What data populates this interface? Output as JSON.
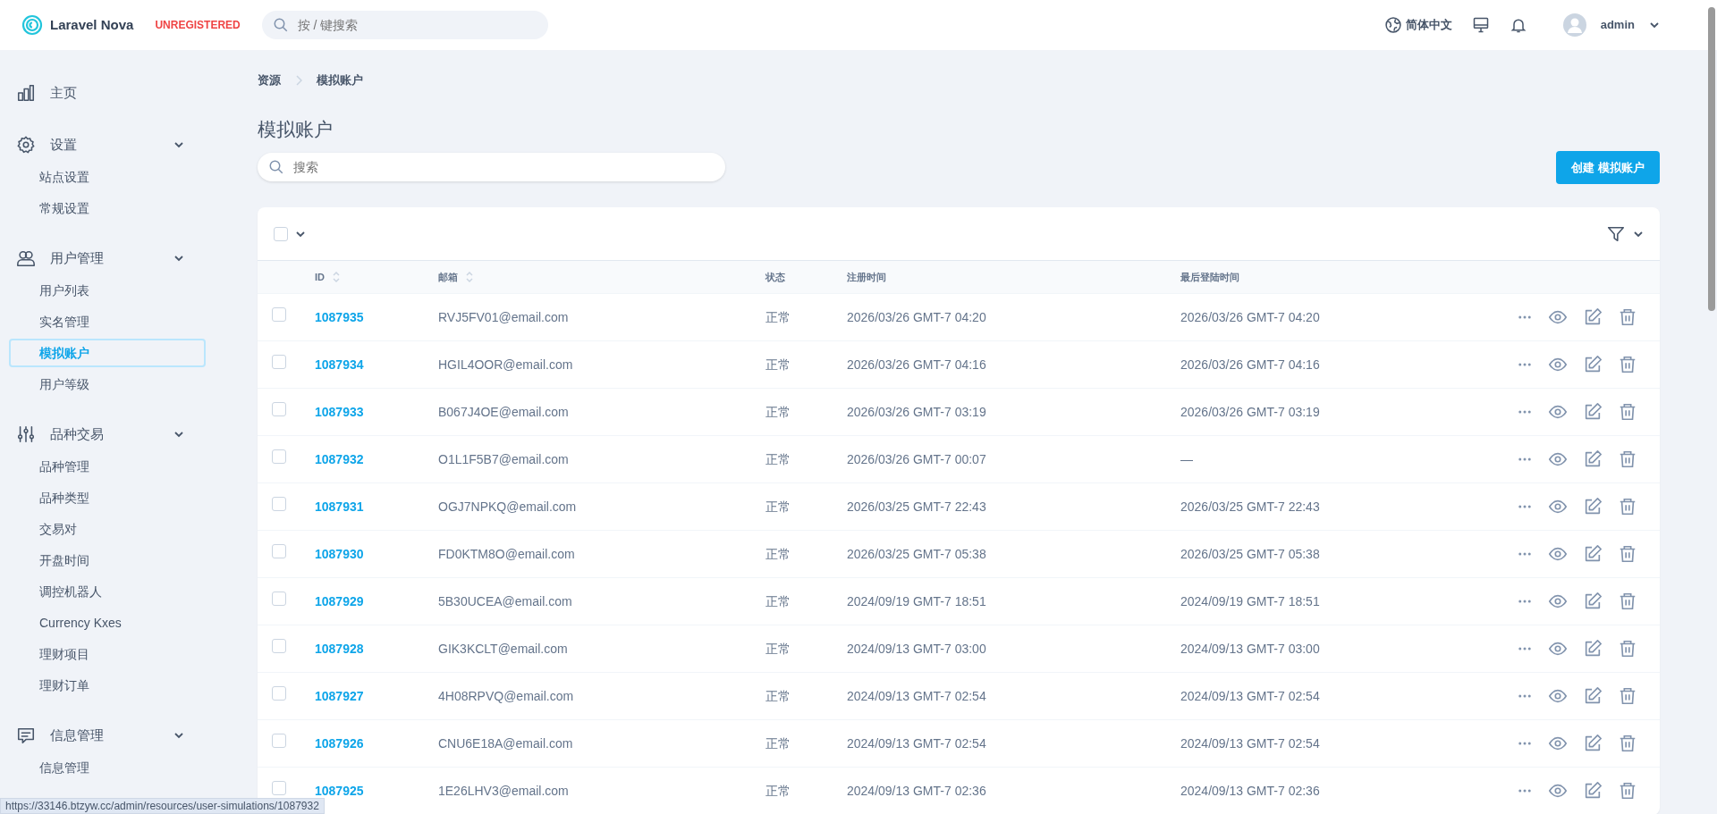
{
  "header": {
    "brand": "Laravel Nova",
    "license": "UNREGISTERED",
    "search": {
      "placeholder": "按 / 键搜索"
    },
    "language": "简体中文",
    "user": "admin"
  },
  "sidebar": {
    "groups": [
      {
        "label": "主页"
      },
      {
        "label": "设置",
        "expanded": true,
        "children": [
          {
            "label": "站点设置",
            "selected": false
          },
          {
            "label": "常规设置",
            "selected": false
          }
        ]
      },
      {
        "label": "用户管理",
        "expanded": true,
        "children": [
          {
            "label": "用户列表",
            "selected": false
          },
          {
            "label": "实名管理",
            "selected": false
          },
          {
            "label": "模拟账户",
            "selected": true
          },
          {
            "label": "用户等级",
            "selected": false
          }
        ]
      },
      {
        "label": "品种交易",
        "expanded": true,
        "children": [
          {
            "label": "品种管理",
            "selected": false
          },
          {
            "label": "品种类型",
            "selected": false
          },
          {
            "label": "交易对",
            "selected": false
          },
          {
            "label": "开盘时间",
            "selected": false
          },
          {
            "label": "调控机器人",
            "selected": false
          },
          {
            "label": "Currency Kxes",
            "selected": false
          },
          {
            "label": "理财项目",
            "selected": false
          },
          {
            "label": "理财订单",
            "selected": false
          }
        ]
      },
      {
        "label": "信息管理",
        "expanded": true,
        "children": [
          {
            "label": "信息管理",
            "selected": false
          }
        ]
      }
    ]
  },
  "breadcrumb": [
    "资源",
    "模拟账户"
  ],
  "title": "模拟账户",
  "search": {
    "placeholder": "搜索"
  },
  "create_button": "创建 模拟账户",
  "table": {
    "select_all": {
      "checked": false
    },
    "columns": [
      {
        "label": "ID",
        "sortable": true
      },
      {
        "label": "邮箱",
        "sortable": true
      },
      {
        "label": "状态",
        "sortable": false
      },
      {
        "label": "注册时间",
        "sortable": false
      },
      {
        "label": "最后登陆时间",
        "sortable": false
      }
    ],
    "rows": [
      {
        "id": "1087935",
        "email": "RVJ5FV01@email.com",
        "status": "正常",
        "registered": "2026/03/26 GMT-7 04:20",
        "last_login": "2026/03/26 GMT-7 04:20",
        "checked": false
      },
      {
        "id": "1087934",
        "email": "HGIL4OOR@email.com",
        "status": "正常",
        "registered": "2026/03/26 GMT-7 04:16",
        "last_login": "2026/03/26 GMT-7 04:16",
        "checked": false
      },
      {
        "id": "1087933",
        "email": "B067J4OE@email.com",
        "status": "正常",
        "registered": "2026/03/26 GMT-7 03:19",
        "last_login": "2026/03/26 GMT-7 03:19",
        "checked": false
      },
      {
        "id": "1087932",
        "email": "O1L1F5B7@email.com",
        "status": "正常",
        "registered": "2026/03/26 GMT-7 00:07",
        "last_login": "—",
        "checked": false
      },
      {
        "id": "1087931",
        "email": "OGJ7NPKQ@email.com",
        "status": "正常",
        "registered": "2026/03/25 GMT-7 22:43",
        "last_login": "2026/03/25 GMT-7 22:43",
        "checked": false
      },
      {
        "id": "1087930",
        "email": "FD0KTM8O@email.com",
        "status": "正常",
        "registered": "2026/03/25 GMT-7 05:38",
        "last_login": "2026/03/25 GMT-7 05:38",
        "checked": false
      },
      {
        "id": "1087929",
        "email": "5B30UCEA@email.com",
        "status": "正常",
        "registered": "2024/09/19 GMT-7 18:51",
        "last_login": "2024/09/19 GMT-7 18:51",
        "checked": false
      },
      {
        "id": "1087928",
        "email": "GIK3KCLT@email.com",
        "status": "正常",
        "registered": "2024/09/13 GMT-7 03:00",
        "last_login": "2024/09/13 GMT-7 03:00",
        "checked": false
      },
      {
        "id": "1087927",
        "email": "4H08RPVQ@email.com",
        "status": "正常",
        "registered": "2024/09/13 GMT-7 02:54",
        "last_login": "2024/09/13 GMT-7 02:54",
        "checked": false
      },
      {
        "id": "1087926",
        "email": "CNU6E18A@email.com",
        "status": "正常",
        "registered": "2024/09/13 GMT-7 02:54",
        "last_login": "2024/09/13 GMT-7 02:54",
        "checked": false
      },
      {
        "id": "1087925",
        "email": "1E26LHV3@email.com",
        "status": "正常",
        "registered": "2024/09/13 GMT-7 02:36",
        "last_login": "2024/09/13 GMT-7 02:36",
        "checked": false
      }
    ]
  },
  "status_url": "https://33146.btzyw.cc/admin/resources/user-simulations/1087932"
}
